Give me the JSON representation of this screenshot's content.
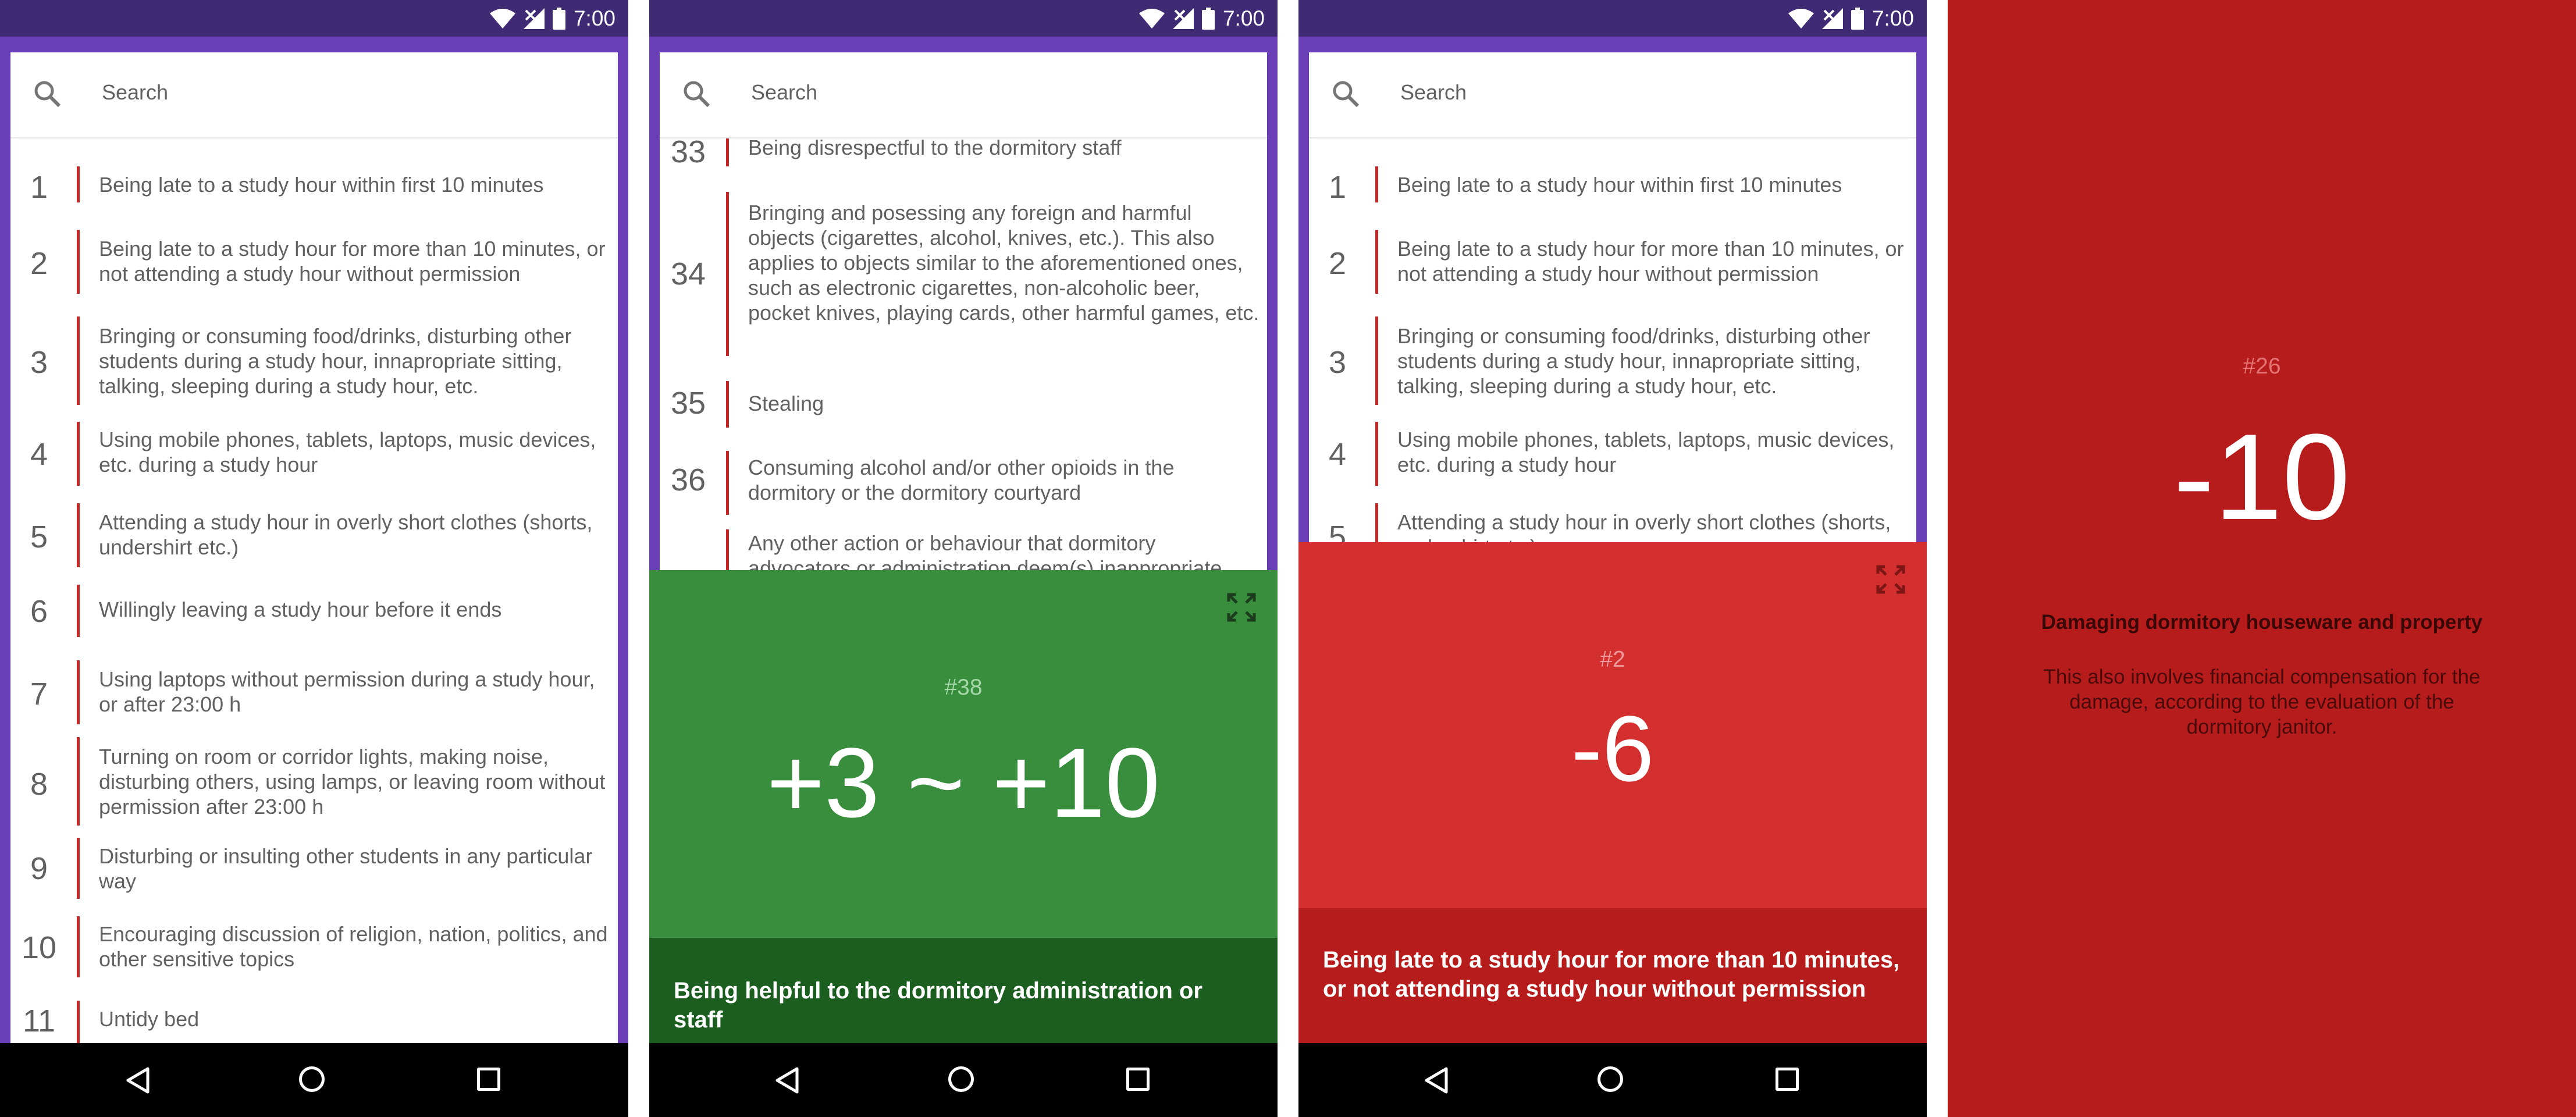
{
  "status": {
    "time": "7:00"
  },
  "search": {
    "placeholder": "Search"
  },
  "screen1": {
    "rules": [
      {
        "num": "1",
        "text": "Being late to a study hour within first 10 minutes"
      },
      {
        "num": "2",
        "text": "Being late to a study hour for more than 10 minutes, or not attending a study hour without permission"
      },
      {
        "num": "3",
        "text": "Bringing or consuming food/drinks, disturbing other students during a study hour, innapropriate sitting, talking, sleeping during a study hour, etc."
      },
      {
        "num": "4",
        "text": "Using mobile phones, tablets, laptops, music devices, etc. during a study hour"
      },
      {
        "num": "5",
        "text": "Attending a study hour in overly short clothes (shorts, undershirt etc.)"
      },
      {
        "num": "6",
        "text": "Willingly leaving a study hour before it ends"
      },
      {
        "num": "7",
        "text": "Using laptops without permission during a study hour, or after 23:00 h"
      },
      {
        "num": "8",
        "text": "Turning on room or corridor lights, making noise, disturbing others, using lamps, or leaving room without permission after 23:00 h"
      },
      {
        "num": "9",
        "text": "Disturbing or insulting other students in any particular way"
      },
      {
        "num": "10",
        "text": "Encouraging discussion of religion, nation, politics, and other sensitive topics"
      },
      {
        "num": "11",
        "text": "Untidy bed"
      }
    ]
  },
  "screen2": {
    "rules": [
      {
        "num": "33",
        "text": "Being disrespectful to the dormitory staff"
      },
      {
        "num": "34",
        "text": "Bringing and posessing any foreign and harmful objects (cigarettes, alcohol, knives, etc.). This also applies to objects similar to the aforementioned ones, such as electronic cigarettes, non-alcoholic beer, pocket knives, playing cards, other harmful games, etc."
      },
      {
        "num": "35",
        "text": "Stealing"
      },
      {
        "num": "36",
        "text": "Consuming alcohol and/or other opioids in the dormitory or the dormitory courtyard"
      },
      {
        "num": "",
        "text": "Any other action or behaviour that dormitory advocators or administration deem(s) inappropriate"
      }
    ],
    "detail": {
      "number": "#38",
      "value": "+3 ~ +10",
      "description": "Being helpful to the dormitory administration or staff",
      "color": "#388e3c",
      "footer_color": "#1b5e20"
    }
  },
  "screen3": {
    "rules": [
      {
        "num": "1",
        "text": "Being late to a study hour within first 10 minutes"
      },
      {
        "num": "2",
        "text": "Being late to a study hour for more than 10 minutes, or not attending a study hour without permission"
      },
      {
        "num": "3",
        "text": "Bringing or consuming food/drinks, disturbing other students during a study hour, innapropriate sitting, talking, sleeping during a study hour, etc."
      },
      {
        "num": "4",
        "text": "Using mobile phones, tablets, laptops, music devices, etc. during a study hour"
      },
      {
        "num": "5",
        "text": "Attending a study hour in overly short clothes (shorts, undershirt etc.)"
      }
    ],
    "detail": {
      "number": "#2",
      "value": "-6",
      "description": "Being late to a study hour for more than 10 minutes, or not attending a study hour without permission",
      "color": "#d32f2f",
      "footer_color": "#b71c1c"
    }
  },
  "screen4": {
    "number": "#26",
    "value": "-10",
    "title": "Damaging dormitory houseware and property",
    "description": "This also involves financial compensation for the damage, according to the evaluation of the dormitory janitor.",
    "color": "#b71c1c"
  }
}
